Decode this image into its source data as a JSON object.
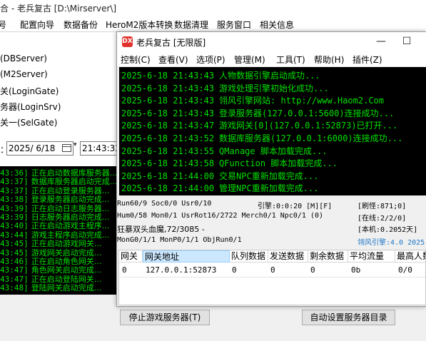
{
  "background_window": {
    "title": "合 - 老兵复古 [D:\\Mirserver\\]",
    "menu": [
      "号",
      "配置向导",
      "数据备份",
      "HeroM2版本转换",
      "数据清理",
      "服务窗口",
      "相关信息"
    ],
    "services": [
      "(DBServer)",
      "(M2Server)",
      "关(LoginGate)",
      "务器(LoginSrv)",
      "关一(SelGate)"
    ],
    "date_label": "：",
    "date_value": "2025/ 6/18",
    "date_dropdown_symbol": "▾",
    "time_value": "21:43:32",
    "log_lines": [
      {
        "time": "43:36]",
        "text": "正在启动数据库服务器..."
      },
      {
        "time": "43:37]",
        "text": "数据库服务器启动完成..."
      },
      {
        "time": "43:37]",
        "text": "正在启动登录服务器..."
      },
      {
        "time": "43:38]",
        "text": "登录服务器启动完成..."
      },
      {
        "time": "43:39]",
        "text": "正在启动日志服务器..."
      },
      {
        "time": "43:39]",
        "text": "日志服务器启动完成..."
      },
      {
        "time": "43:40]",
        "text": "正在启动游戏主程序..."
      },
      {
        "time": "43:44]",
        "text": "游戏主程序启动完成..."
      },
      {
        "time": "43:45]",
        "text": "正在启动游戏网关..."
      },
      {
        "time": "43:45]",
        "text": "游戏网关启动完成..."
      },
      {
        "time": "43:46]",
        "text": "正在启动角色网关..."
      },
      {
        "time": "43:47]",
        "text": "角色网关启动完成..."
      },
      {
        "time": "43:47]",
        "text": "正在启动登陆网关..."
      },
      {
        "time": "43:48]",
        "text": "登陆网关启动完成..."
      }
    ],
    "btn_stop": "停止游戏服务器(T)",
    "btn_auto": "自动设置服务器目录"
  },
  "front_window": {
    "app_icon_text": "DX",
    "title": "老兵复古 [无限版]",
    "minimize_symbol": "—",
    "maximize_symbol": "☐",
    "menu": [
      "控制(C)",
      "查看(V)",
      "选项(P)",
      "管理(M)",
      "工具(T)",
      "帮助(H)",
      "插件(Z)"
    ],
    "log_lines": [
      {
        "time": "2025-6-18 21:43:43",
        "text": "人物数据引擎启动成功..."
      },
      {
        "time": "2025-6-18 21:43:43",
        "text": "游戏处理引擎初始化成功..."
      },
      {
        "time": "2025-6-18 21:43:43",
        "text": "翎风引擎网站: http://www.Haom2.Com"
      },
      {
        "time": "2025-6-18 21:43:43",
        "text": "登录服务器(127.0.0.1:5600)连接成功..."
      },
      {
        "time": "2025-6-18 21:43:47",
        "text": "游戏网关[0](127.0.0.1:52873)已打开..."
      },
      {
        "time": "2025-6-18 21:43:52",
        "text": "数据库服务器(127.0.0.1:6000)连接成功..."
      },
      {
        "time": "2025-6-18 21:43:55",
        "text": "QManage 脚本加载完成..."
      },
      {
        "time": "2025-6-18 21:43:58",
        "text": "QFunction 脚本加载完成..."
      },
      {
        "time": "2025-6-18 21:44:00",
        "text": "交易NPC重新加载完成..."
      },
      {
        "time": "2025-6-18 21:44:00",
        "text": "管理NPC重新加载完成..."
      }
    ],
    "status": {
      "run": "Run60/9 Soc0/0 Usr0/10",
      "engine": "引擎:0:0:20 [M][F]",
      "refresh": "[刷怪:871;0]",
      "hum": "Hum0/58 Mon0/1 UsrRot16/2722 Merch0/1 Npc0/1 (0)",
      "online": "[在线:2/2/0]",
      "monster": "狂暴双头血魔,72/3085 -",
      "version": "[本机:0.2052天]",
      "mongo": "MonG0/1/1 MonP0/1/1 ObjRun0/1",
      "engine_ver": "翎风引擎:4.0 2025"
    },
    "table": {
      "headers": [
        "网关",
        "网关地址",
        "队列数据",
        "发送数据",
        "剩余数据",
        "平均流量",
        "最高人数"
      ],
      "rows": [
        [
          "0",
          "127.0.0.1:52873",
          "0",
          "0",
          "0",
          "0b",
          "0/0"
        ]
      ]
    }
  }
}
